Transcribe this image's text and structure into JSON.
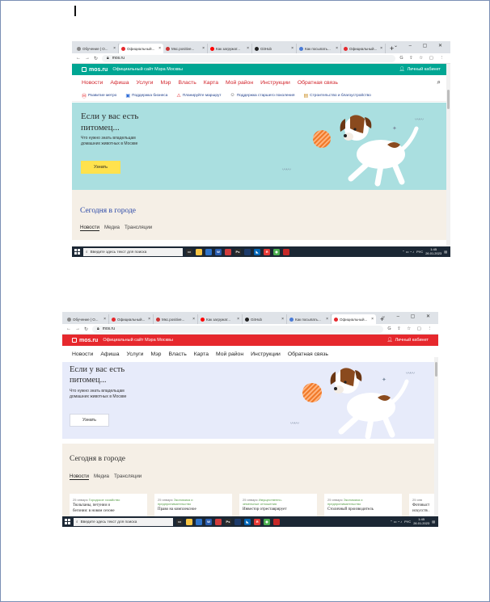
{
  "colors": {
    "mos_teal": "#00a693",
    "mos_red": "#e6282d",
    "nav_red_text": "#d2232a",
    "hero_teal": "#aadfe0",
    "hero_lavender": "#e7ebfa",
    "today_bg": "#f5efe6",
    "yellow_btn": "#ffe24d"
  },
  "browser": {
    "tabs": [
      "Обучение | О...",
      "Официальный...",
      "Мкс.positive...",
      "Как загружат...",
      "GitHub",
      "Как посыпать...",
      "Официальный..."
    ],
    "tabs2": [
      "Обучение | О...",
      "Официальный...",
      "Мкс.positive...",
      "Как загружат...",
      "GitHub",
      "Как посыпать...",
      "Официальный..."
    ],
    "url": "mos.ru",
    "plus": "+"
  },
  "site": {
    "logo": "mos.ru",
    "tagline": "Официальный сайт Мэра Москвы",
    "cabinet": "Личный кабинет",
    "nav": [
      "Новости",
      "Афиша",
      "Услуги",
      "Мэр",
      "Власть",
      "Карта",
      "Мой район",
      "Инструкции",
      "Обратная связь"
    ],
    "quick": [
      {
        "icon": "metro-icon",
        "label": "Развитие метро"
      },
      {
        "icon": "business-icon",
        "label": "Поддержка бизнеса"
      },
      {
        "icon": "route-icon",
        "label": "Планируйте маршрут"
      },
      {
        "icon": "elderly-icon",
        "label": "Поддержка старшего поколения"
      },
      {
        "icon": "construction-icon",
        "label": "Строительство и благоустройство"
      }
    ]
  },
  "hero": {
    "title_line1": "Если у вас есть",
    "title_line2": "питомец...",
    "sub_line1": "Что нужно знать владельцам",
    "sub_line2": "домашних животных в Москве",
    "button": "Узнать"
  },
  "today": {
    "title": "Сегодня в городе",
    "tabs": [
      "Новости",
      "Медиа",
      "Трансляции"
    ]
  },
  "cards": [
    {
      "date": "25 января",
      "cat1": "Городское хозяйство",
      "cat2": "",
      "title1": "Тюльпаны, петунии и",
      "title2": "бегонии: в новом сезоне"
    },
    {
      "date": "25 января",
      "cat1": "Экономика и",
      "cat2": "предпринимательство",
      "title1": "Право на комплексное",
      "title2": ""
    },
    {
      "date": "25 января",
      "cat1": "Имущественно-",
      "cat2": "земельные отношения",
      "title1": "Инвестор отреставрирует",
      "title2": ""
    },
    {
      "date": "25 января",
      "cat1": "Экономика и",
      "cat2": "предпринимательство",
      "title1": "Столичный производитель",
      "title2": ""
    },
    {
      "date": "25 янв",
      "cat1": "",
      "cat2": "",
      "title1": "Фотовыст",
      "title2": "искусств ."
    }
  ],
  "taskbar": {
    "search": "Введите здесь текст для поиска",
    "lang": "РУС",
    "time": "1:45",
    "date": "26.01.2023"
  }
}
